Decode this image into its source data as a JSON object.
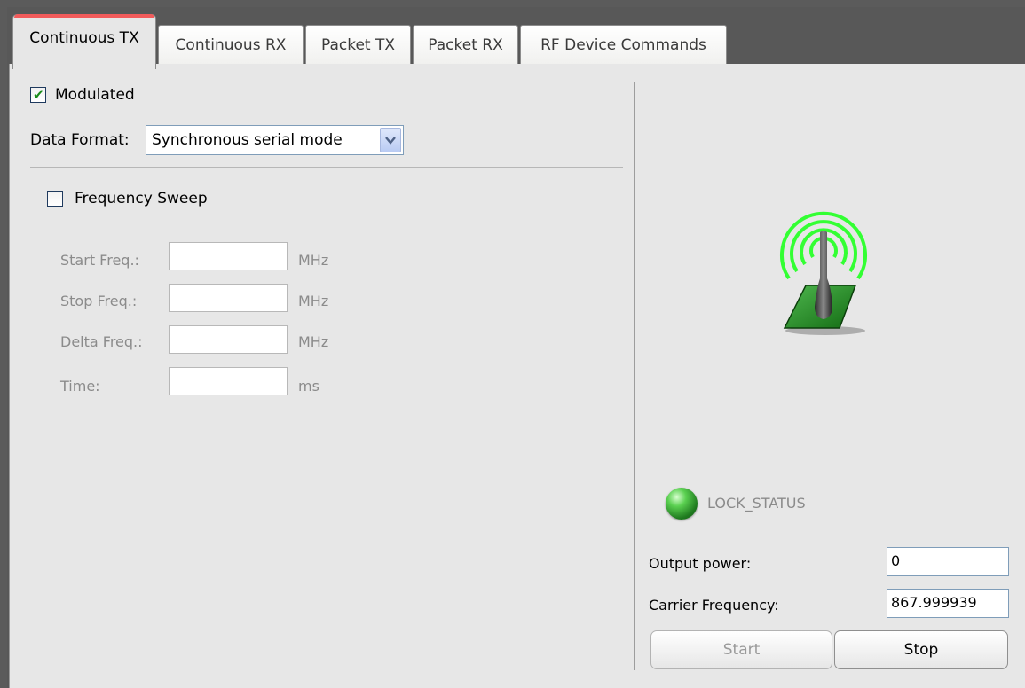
{
  "tabs": [
    {
      "label": "Continuous TX",
      "active": true
    },
    {
      "label": "Continuous RX",
      "active": false
    },
    {
      "label": "Packet TX",
      "active": false
    },
    {
      "label": "Packet RX",
      "active": false
    },
    {
      "label": "RF Device Commands",
      "active": false
    }
  ],
  "left": {
    "modulated": {
      "label": "Modulated",
      "checked": true
    },
    "data_format": {
      "label": "Data Format:",
      "value": "Synchronous serial mode"
    },
    "frequency_sweep": {
      "label": "Frequency Sweep",
      "checked": false
    },
    "sweep_fields": [
      {
        "label": "Start Freq.:",
        "value": "",
        "unit": "MHz"
      },
      {
        "label": "Stop Freq.:",
        "value": "",
        "unit": "MHz"
      },
      {
        "label": "Delta Freq.:",
        "value": "",
        "unit": "MHz"
      },
      {
        "label": "Time:",
        "value": "",
        "unit": "ms"
      }
    ]
  },
  "right": {
    "lock_status": "LOCK_STATUS",
    "output_power": {
      "label": "Output power:",
      "value": "0"
    },
    "carrier_frequency": {
      "label": "Carrier Frequency:",
      "value": "867.999939"
    },
    "start_label": "Start",
    "stop_label": "Stop"
  },
  "colors": {
    "active_tab_highlight": "#f25b5b",
    "lock_led": "#3cb83c",
    "antenna_waves": "#33ff33"
  },
  "icons": {
    "antenna": "antenna-transmitter-icon",
    "led": "status-led-icon",
    "check": "check-icon",
    "dropdown": "chevron-down-icon"
  }
}
